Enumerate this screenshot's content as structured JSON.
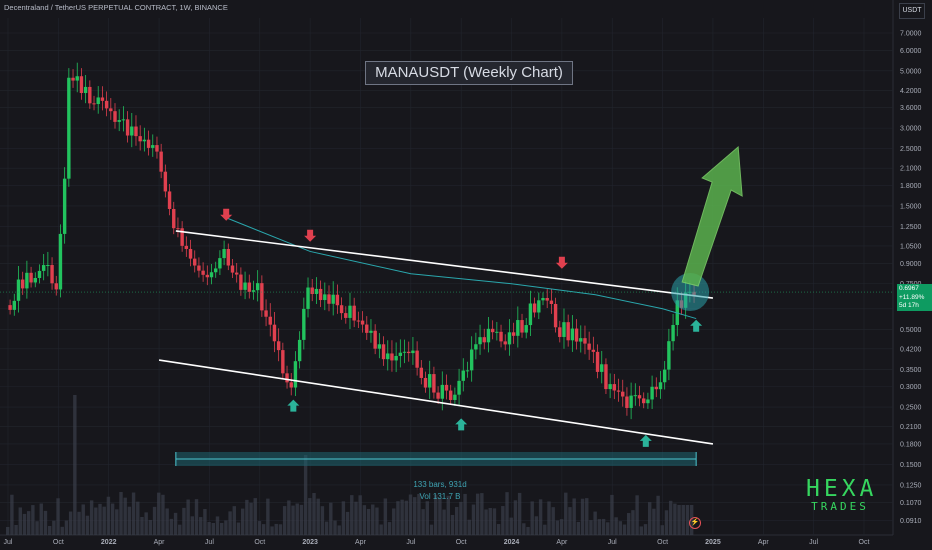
{
  "chart_data": {
    "type": "candlestick",
    "header": "Decentraland / TetherUS PERPETUAL CONTRACT, 1W, BINANCE",
    "title": "MANAUSDT (Weekly Chart)",
    "currency": "USDT",
    "scale": "log",
    "ylim": [
      0.08,
      8.0
    ],
    "y_ticks": [
      7.0,
      6.0,
      5.0,
      4.2,
      3.6,
      3.0,
      2.5,
      2.1,
      1.8,
      1.5,
      1.25,
      1.05,
      0.9,
      0.75,
      0.6,
      0.5,
      0.42,
      0.35,
      0.3,
      0.25,
      0.21,
      0.18,
      0.15,
      0.125,
      0.107,
      0.091
    ],
    "y_tick_labels": [
      "7.0000",
      "6.0000",
      "5.0000",
      "4.2000",
      "3.6000",
      "3.0000",
      "2.5000",
      "2.1000",
      "1.8000",
      "1.5000",
      "1.2500",
      "1.0500",
      "0.9000",
      "0.7500",
      "",
      "0.5000",
      "0.4200",
      "0.3500",
      "0.3000",
      "0.2500",
      "0.2100",
      "0.1800",
      "0.1500",
      "0.1250",
      "0.1070",
      "0.0910"
    ],
    "x_ticks": [
      "Jul",
      "Oct",
      "2022",
      "Apr",
      "Jul",
      "Oct",
      "2023",
      "Apr",
      "Jul",
      "Oct",
      "2024",
      "Apr",
      "Jul",
      "Oct",
      "2025",
      "Apr",
      "Jul",
      "Oct"
    ],
    "x_tick_dates": [
      "2021-07",
      "2021-10",
      "2022-01",
      "2022-04",
      "2022-07",
      "2022-10",
      "2023-01",
      "2023-04",
      "2023-07",
      "2023-10",
      "2024-01",
      "2024-04",
      "2024-07",
      "2024-10",
      "2025-01",
      "2025-04",
      "2025-07",
      "2025-10"
    ],
    "current_price": 0.6967,
    "price_label": [
      "0.6967",
      "+11.89%",
      "5d 17h"
    ],
    "closes": [
      {
        "date": "2021-07",
        "c": 0.62
      },
      {
        "date": "2021-08",
        "c": 0.75
      },
      {
        "date": "2021-09",
        "c": 0.9
      },
      {
        "date": "2021-10",
        "c": 0.75
      },
      {
        "date": "2021-11",
        "c": 4.5
      },
      {
        "date": "2021-12",
        "c": 4.0
      },
      {
        "date": "2022-01",
        "c": 3.6
      },
      {
        "date": "2022-02",
        "c": 3.0
      },
      {
        "date": "2022-03",
        "c": 2.6
      },
      {
        "date": "2022-04",
        "c": 2.5
      },
      {
        "date": "2022-05",
        "c": 1.3
      },
      {
        "date": "2022-06",
        "c": 0.95
      },
      {
        "date": "2022-07",
        "c": 0.8
      },
      {
        "date": "2022-08",
        "c": 1.05
      },
      {
        "date": "2022-09",
        "c": 0.75
      },
      {
        "date": "2022-10",
        "c": 0.7
      },
      {
        "date": "2022-11",
        "c": 0.42
      },
      {
        "date": "2022-12",
        "c": 0.3
      },
      {
        "date": "2023-01",
        "c": 0.72
      },
      {
        "date": "2023-02",
        "c": 0.65
      },
      {
        "date": "2023-03",
        "c": 0.6
      },
      {
        "date": "2023-04",
        "c": 0.55
      },
      {
        "date": "2023-05",
        "c": 0.45
      },
      {
        "date": "2023-06",
        "c": 0.35
      },
      {
        "date": "2023-07",
        "c": 0.4
      },
      {
        "date": "2023-08",
        "c": 0.32
      },
      {
        "date": "2023-09",
        "c": 0.28
      },
      {
        "date": "2023-10",
        "c": 0.3
      },
      {
        "date": "2023-11",
        "c": 0.42
      },
      {
        "date": "2023-12",
        "c": 0.5
      },
      {
        "date": "2024-01",
        "c": 0.45
      },
      {
        "date": "2024-02",
        "c": 0.55
      },
      {
        "date": "2024-03",
        "c": 0.72
      },
      {
        "date": "2024-04",
        "c": 0.5
      },
      {
        "date": "2024-05",
        "c": 0.45
      },
      {
        "date": "2024-06",
        "c": 0.38
      },
      {
        "date": "2024-07",
        "c": 0.3
      },
      {
        "date": "2024-08",
        "c": 0.25
      },
      {
        "date": "2024-09",
        "c": 0.28
      },
      {
        "date": "2024-10",
        "c": 0.3
      },
      {
        "date": "2024-11",
        "c": 0.6
      },
      {
        "date": "2024-12",
        "c": 0.6967
      }
    ],
    "ma_line": [
      {
        "date": "2022-08",
        "v": 1.35
      },
      {
        "date": "2023-01",
        "v": 1.0
      },
      {
        "date": "2023-07",
        "v": 0.82
      },
      {
        "date": "2024-01",
        "v": 0.75
      },
      {
        "date": "2024-06",
        "v": 0.68
      },
      {
        "date": "2024-10",
        "v": 0.6
      },
      {
        "date": "2024-12",
        "v": 0.55
      }
    ],
    "trendlines": [
      {
        "name": "upper",
        "from": {
          "date": "2022-05",
          "v": 1.2
        },
        "to": {
          "date": "2025-01",
          "v": 0.66
        }
      },
      {
        "name": "lower",
        "from": {
          "date": "2022-04",
          "v": 0.38
        },
        "to": {
          "date": "2025-01",
          "v": 0.18
        }
      }
    ],
    "markers_down": [
      {
        "date": "2022-08",
        "v": 1.35
      },
      {
        "date": "2023-01",
        "v": 1.12
      },
      {
        "date": "2024-04",
        "v": 0.88
      }
    ],
    "markers_up": [
      {
        "date": "2022-12",
        "v": 0.26
      },
      {
        "date": "2023-10",
        "v": 0.22
      },
      {
        "date": "2024-09",
        "v": 0.19
      },
      {
        "date": "2024-12",
        "v": 0.53
      }
    ],
    "measure": {
      "bars_text": "133 bars, 931d",
      "volume_text": "Vol 131.7 B",
      "from": "2022-05",
      "to": "2024-12"
    },
    "watermark": {
      "line1": "HEXA",
      "line2": "TRADES"
    },
    "colors": {
      "up": "#22c35e",
      "down": "#e0404f",
      "ma": "#2aa7ad",
      "trend": "#ffffff",
      "arrow": "#5ab24e",
      "highlight": "#2aa0aa",
      "volume": "#3a3f4a",
      "background": "#17171c",
      "grid": "#22252d",
      "axis_text": "#a9adb8"
    }
  }
}
